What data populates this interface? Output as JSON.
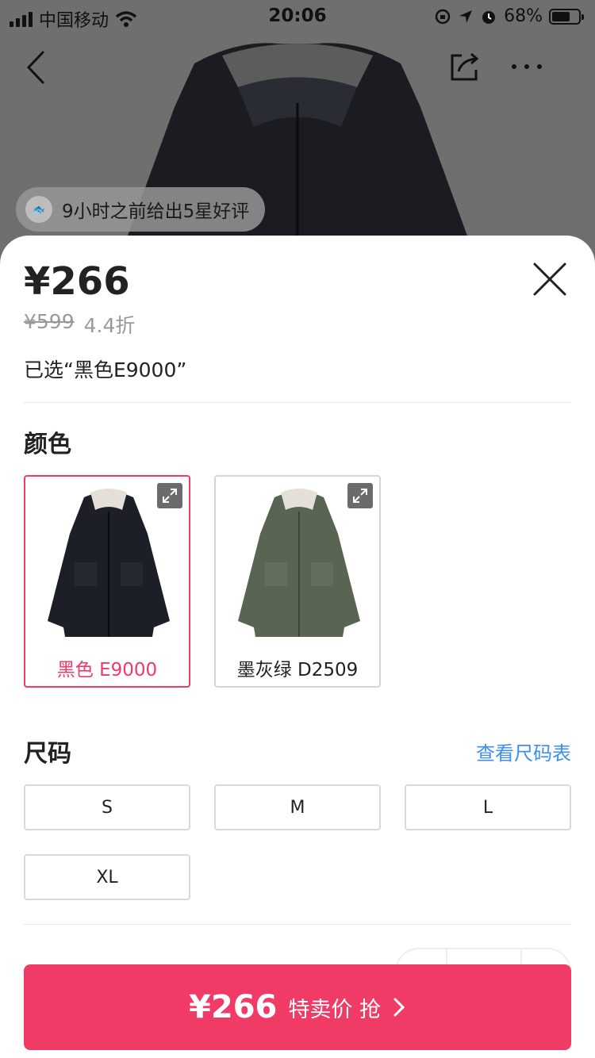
{
  "status_bar": {
    "carrier": "中国移动",
    "time": "20:06",
    "battery": "68%",
    "battery_level": 0.68
  },
  "background": {
    "review_text": "9小时之前给出5星好评",
    "nav_icons": [
      "back-icon",
      "share-icon",
      "more-icon"
    ]
  },
  "sheet": {
    "price": "¥266",
    "original_price": "¥599",
    "discount": "4.4折",
    "selected_text": "已选“黑色E9000”",
    "color_section": {
      "title": "颜色",
      "options": [
        {
          "label": "黑色 E9000",
          "selected": true,
          "color": "#1d1f26"
        },
        {
          "label": "墨灰绿 D2509",
          "selected": false,
          "color": "#5a6452"
        }
      ]
    },
    "size_section": {
      "title": "尺码",
      "size_chart_link": "查看尺码表",
      "options": [
        "S",
        "M",
        "L",
        "XL"
      ]
    },
    "buy_button": {
      "price": "¥266",
      "label": "特卖价 抢",
      "color": "#f13b67"
    }
  },
  "colors": {
    "accent": "#ef3a6a",
    "link": "#3b8ff0"
  }
}
